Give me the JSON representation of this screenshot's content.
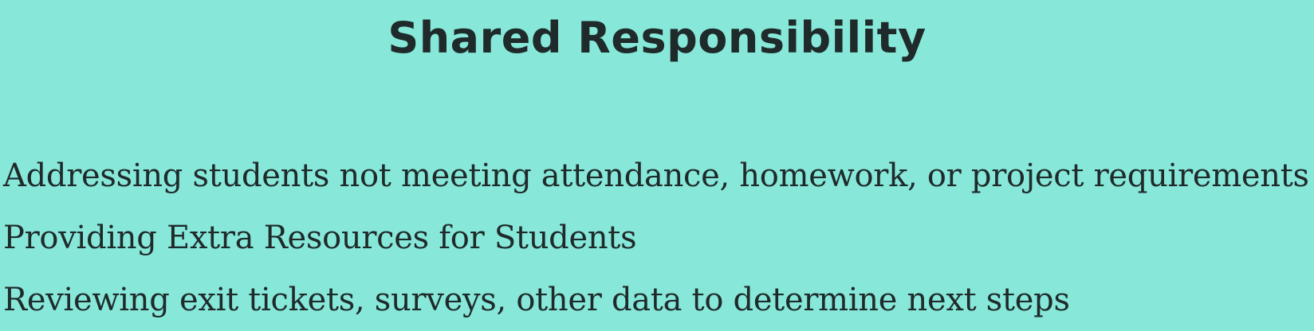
{
  "slide": {
    "title": "Shared Responsibility",
    "items": [
      "Addressing students not meeting attendance, homework, or project requirements",
      "Providing Extra Resources for Students",
      "Reviewing exit tickets, surveys, other data to determine next steps"
    ]
  },
  "colors": {
    "background": "#87e8da",
    "text": "#1f2a2a"
  }
}
